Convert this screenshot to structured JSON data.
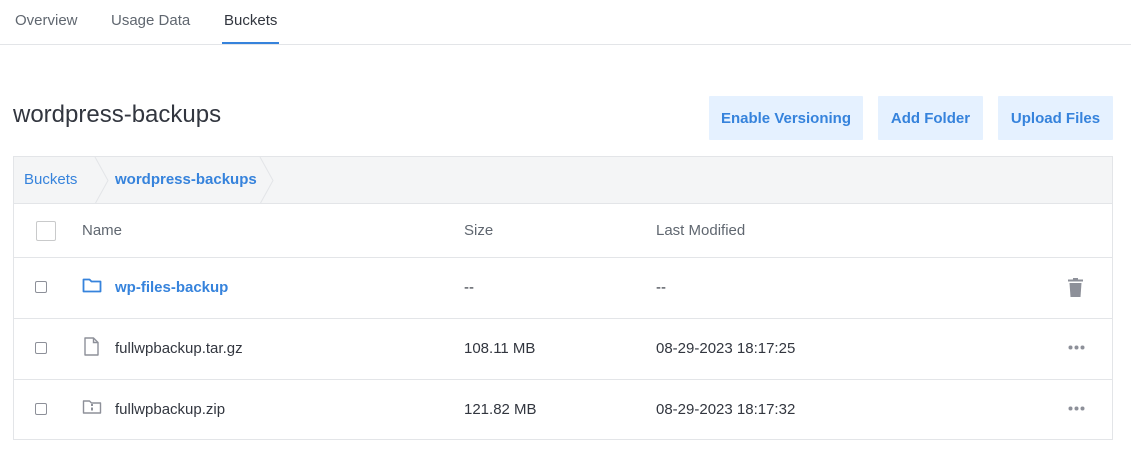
{
  "tabs": [
    {
      "label": "Overview",
      "active": false
    },
    {
      "label": "Usage Data",
      "active": false
    },
    {
      "label": "Buckets",
      "active": true
    }
  ],
  "page": {
    "title": "wordpress-backups"
  },
  "actions": {
    "enable_versioning": "Enable Versioning",
    "add_folder": "Add Folder",
    "upload_files": "Upload Files"
  },
  "breadcrumb": {
    "root": "Buckets",
    "current": "wordpress-backups"
  },
  "table": {
    "columns": {
      "name": "Name",
      "size": "Size",
      "modified": "Last Modified"
    },
    "rows": [
      {
        "type": "folder",
        "icon": "folder-icon",
        "name": "wp-files-backup",
        "size": "--",
        "modified": "--",
        "action_icon": "trash-icon"
      },
      {
        "type": "file",
        "icon": "file-icon",
        "name": "fullwpbackup.tar.gz",
        "size": "108.11 MB",
        "modified": "08-29-2023 18:17:25",
        "action_icon": "more-icon"
      },
      {
        "type": "archive",
        "icon": "zip-file-icon",
        "name": "fullwpbackup.zip",
        "size": "121.82 MB",
        "modified": "08-29-2023 18:17:32",
        "action_icon": "more-icon"
      }
    ]
  },
  "colors": {
    "accent": "#3683dc",
    "accent_bg": "#e5f1ff",
    "border": "#e3e5e8",
    "muted": "#606770"
  }
}
